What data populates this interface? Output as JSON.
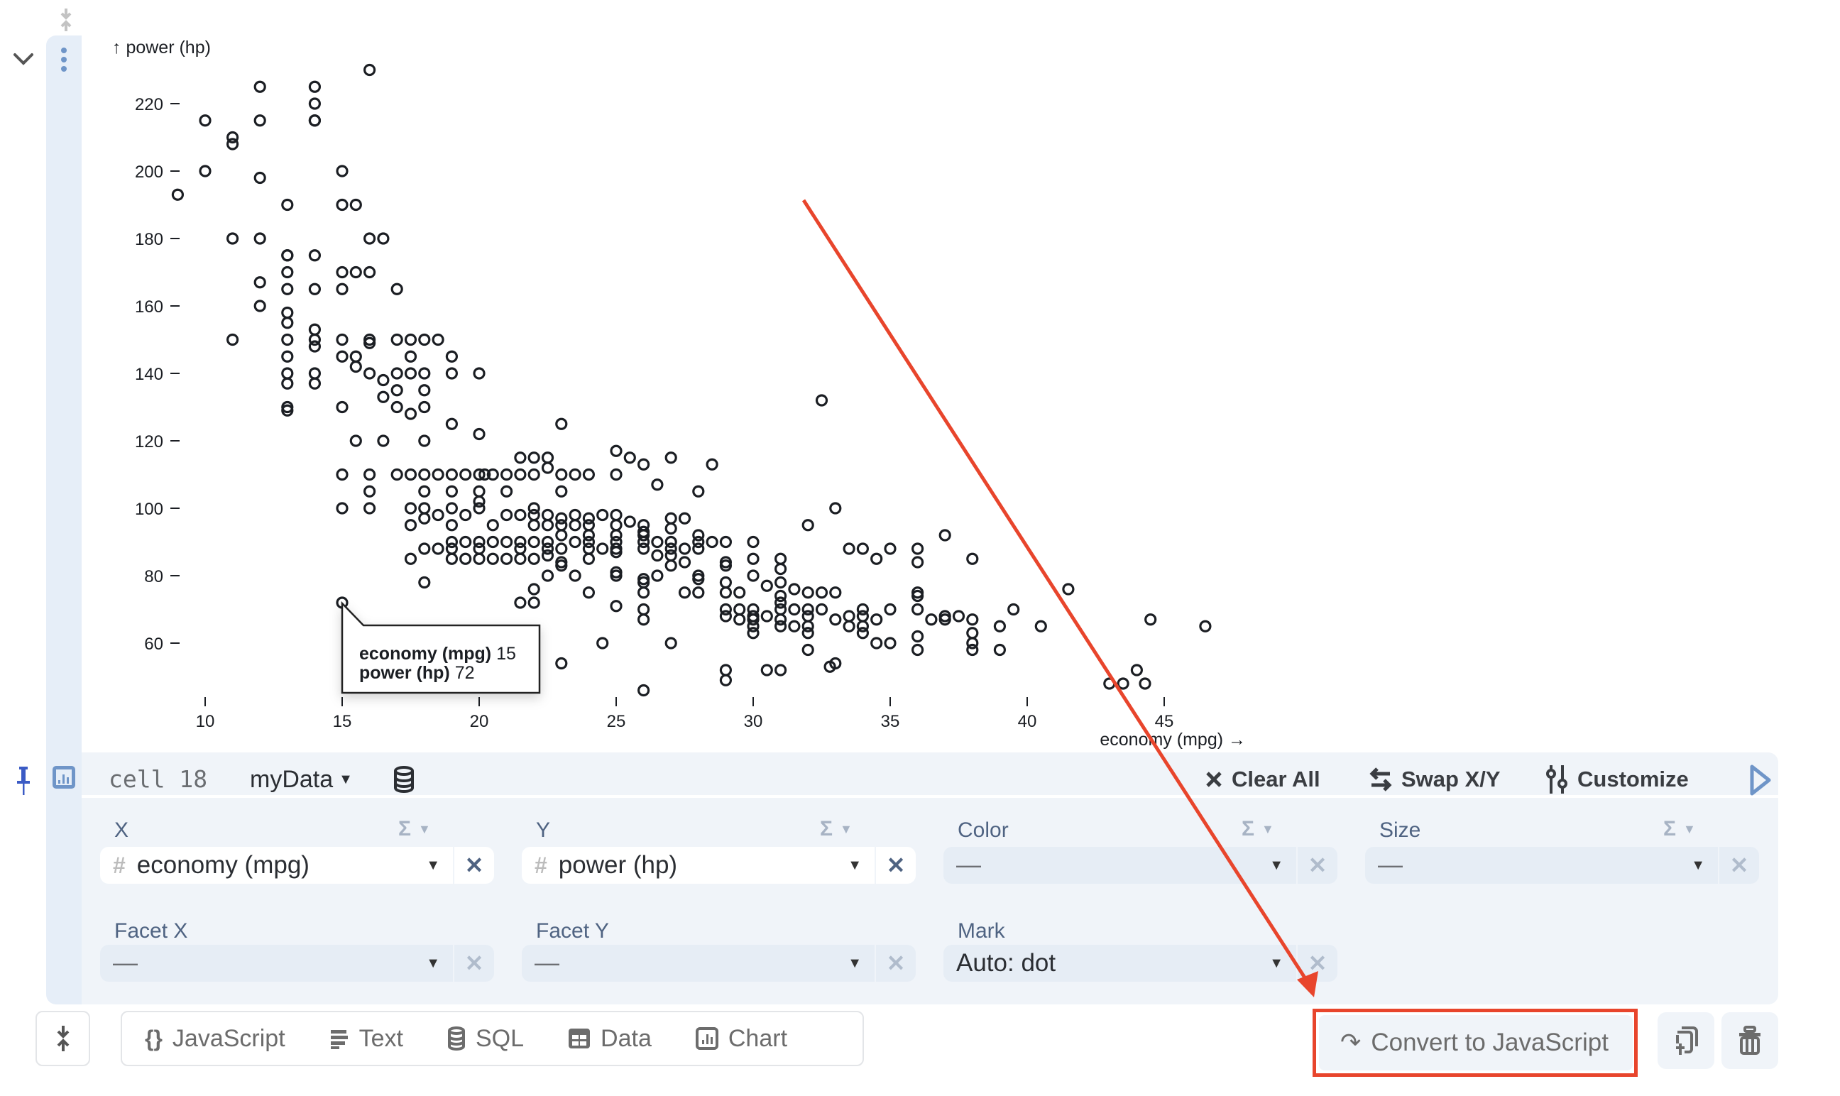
{
  "cell": {
    "label": "cell 18",
    "dataset": "myData",
    "header_buttons": {
      "clear_all": "Clear All",
      "swap": "Swap X/Y",
      "customize": "Customize"
    }
  },
  "fields": {
    "x": {
      "label": "X",
      "value": "economy (mpg)",
      "type_icon": "#"
    },
    "y": {
      "label": "Y",
      "value": "power (hp)",
      "type_icon": "#"
    },
    "color": {
      "label": "Color",
      "value": "—"
    },
    "size": {
      "label": "Size",
      "value": "—"
    },
    "facet_x": {
      "label": "Facet X",
      "value": "—"
    },
    "facet_y": {
      "label": "Facet Y",
      "value": "—"
    },
    "mark": {
      "label": "Mark",
      "value": "Auto: dot"
    },
    "aggregate_symbol": "Σ",
    "clear_symbol": "✕",
    "caret": "▾"
  },
  "toolbar": {
    "add_cells": [
      {
        "label": "JavaScript",
        "icon": "braces-icon"
      },
      {
        "label": "Text",
        "icon": "text-lines-icon"
      },
      {
        "label": "SQL",
        "icon": "database-icon"
      },
      {
        "label": "Data",
        "icon": "table-icon"
      },
      {
        "label": "Chart",
        "icon": "chart-icon"
      }
    ],
    "convert_label": "Convert to JavaScript",
    "convert_icon": "↷"
  },
  "annotation": {
    "color": "#e8452c",
    "target": "convert-button"
  },
  "chart_data": {
    "type": "scatter",
    "title": "",
    "xlabel": "economy (mpg) →",
    "ylabel": "↑ power (hp)",
    "xlim": [
      8.5,
      48
    ],
    "ylim": [
      45,
      233
    ],
    "x_ticks": [
      10,
      15,
      20,
      25,
      30,
      35,
      40,
      45
    ],
    "y_ticks": [
      60,
      80,
      100,
      120,
      140,
      160,
      180,
      200,
      220
    ],
    "grid": false,
    "legend": "none",
    "mark": "dot (hollow circle)",
    "tooltip": {
      "x_label": "economy (mpg)",
      "x_value": 15,
      "y_label": "power (hp)",
      "y_value": 72
    },
    "points": [
      [
        9,
        193
      ],
      [
        10,
        215
      ],
      [
        10,
        200
      ],
      [
        11,
        210
      ],
      [
        11,
        208
      ],
      [
        11,
        180
      ],
      [
        11,
        150
      ],
      [
        12,
        225
      ],
      [
        12,
        215
      ],
      [
        12,
        198
      ],
      [
        12,
        180
      ],
      [
        12,
        167
      ],
      [
        12,
        160
      ],
      [
        13,
        175
      ],
      [
        13,
        175
      ],
      [
        13,
        170
      ],
      [
        13,
        165
      ],
      [
        13,
        158
      ],
      [
        13,
        155
      ],
      [
        13,
        150
      ],
      [
        13,
        145
      ],
      [
        13,
        140
      ],
      [
        13,
        137
      ],
      [
        13,
        130
      ],
      [
        13,
        129
      ],
      [
        13,
        190
      ],
      [
        14,
        225
      ],
      [
        14,
        220
      ],
      [
        14,
        215
      ],
      [
        14,
        175
      ],
      [
        14,
        165
      ],
      [
        14,
        153
      ],
      [
        14,
        150
      ],
      [
        14,
        148
      ],
      [
        14,
        140
      ],
      [
        14,
        137
      ],
      [
        14,
        215
      ],
      [
        15,
        200
      ],
      [
        15,
        190
      ],
      [
        15,
        170
      ],
      [
        15,
        165
      ],
      [
        15,
        150
      ],
      [
        15,
        145
      ],
      [
        15,
        130
      ],
      [
        15,
        110
      ],
      [
        15,
        100
      ],
      [
        15,
        72
      ],
      [
        15.5,
        190
      ],
      [
        15.5,
        170
      ],
      [
        15.5,
        145
      ],
      [
        15.5,
        142
      ],
      [
        15.5,
        120
      ],
      [
        16,
        230
      ],
      [
        16,
        180
      ],
      [
        16,
        170
      ],
      [
        16,
        150
      ],
      [
        16,
        149
      ],
      [
        16,
        140
      ],
      [
        16,
        110
      ],
      [
        16,
        105
      ],
      [
        16,
        100
      ],
      [
        16.5,
        180
      ],
      [
        16.5,
        138
      ],
      [
        16.5,
        133
      ],
      [
        16.5,
        120
      ],
      [
        17,
        165
      ],
      [
        17,
        150
      ],
      [
        17,
        140
      ],
      [
        17,
        135
      ],
      [
        17,
        130
      ],
      [
        17,
        110
      ],
      [
        17.5,
        150
      ],
      [
        17.5,
        145
      ],
      [
        17.5,
        140
      ],
      [
        17.5,
        128
      ],
      [
        17.5,
        110
      ],
      [
        17.5,
        100
      ],
      [
        17.5,
        95
      ],
      [
        17.5,
        85
      ],
      [
        18,
        150
      ],
      [
        18,
        140
      ],
      [
        18,
        135
      ],
      [
        18,
        130
      ],
      [
        18,
        120
      ],
      [
        18,
        110
      ],
      [
        18,
        105
      ],
      [
        18,
        100
      ],
      [
        18,
        97
      ],
      [
        18,
        88
      ],
      [
        18,
        78
      ],
      [
        18.5,
        150
      ],
      [
        18.5,
        110
      ],
      [
        18.5,
        98
      ],
      [
        18.5,
        88
      ],
      [
        19,
        145
      ],
      [
        19,
        140
      ],
      [
        19,
        125
      ],
      [
        19,
        110
      ],
      [
        19,
        105
      ],
      [
        19,
        100
      ],
      [
        19,
        95
      ],
      [
        19,
        90
      ],
      [
        19,
        88
      ],
      [
        19,
        85
      ],
      [
        19.5,
        110
      ],
      [
        19.5,
        98
      ],
      [
        19.5,
        90
      ],
      [
        19.5,
        85
      ],
      [
        20,
        140
      ],
      [
        20,
        122
      ],
      [
        20,
        110
      ],
      [
        20,
        105
      ],
      [
        20,
        102
      ],
      [
        20,
        100
      ],
      [
        20,
        90
      ],
      [
        20,
        88
      ],
      [
        20,
        85
      ],
      [
        20.2,
        110
      ],
      [
        20.5,
        110
      ],
      [
        20.5,
        95
      ],
      [
        20.5,
        90
      ],
      [
        20.5,
        85
      ],
      [
        21,
        110
      ],
      [
        21,
        105
      ],
      [
        21,
        98
      ],
      [
        21,
        90
      ],
      [
        21,
        85
      ],
      [
        21.5,
        115
      ],
      [
        21.5,
        110
      ],
      [
        21.5,
        98
      ],
      [
        21.5,
        90
      ],
      [
        21.5,
        88
      ],
      [
        21.5,
        85
      ],
      [
        21.5,
        72
      ],
      [
        22,
        115
      ],
      [
        22,
        110
      ],
      [
        22,
        100
      ],
      [
        22,
        98
      ],
      [
        22,
        95
      ],
      [
        22,
        90
      ],
      [
        22,
        85
      ],
      [
        22,
        72
      ],
      [
        22,
        76
      ],
      [
        22.5,
        115
      ],
      [
        22.5,
        112
      ],
      [
        22.5,
        98
      ],
      [
        22.5,
        95
      ],
      [
        22.5,
        90
      ],
      [
        22.5,
        88
      ],
      [
        22.5,
        86
      ],
      [
        22.5,
        80
      ],
      [
        23,
        125
      ],
      [
        23,
        110
      ],
      [
        23,
        105
      ],
      [
        23,
        97
      ],
      [
        23,
        95
      ],
      [
        23,
        92
      ],
      [
        23,
        88
      ],
      [
        23,
        84
      ],
      [
        23,
        83
      ],
      [
        23,
        54
      ],
      [
        23.5,
        110
      ],
      [
        23.5,
        98
      ],
      [
        23.5,
        95
      ],
      [
        23.5,
        90
      ],
      [
        23.5,
        80
      ],
      [
        24,
        110
      ],
      [
        24,
        97
      ],
      [
        24,
        95
      ],
      [
        24,
        92
      ],
      [
        24,
        90
      ],
      [
        24,
        88
      ],
      [
        24,
        85
      ],
      [
        24,
        75
      ],
      [
        24.5,
        98
      ],
      [
        24.5,
        88
      ],
      [
        24.5,
        60
      ],
      [
        25,
        117
      ],
      [
        25,
        110
      ],
      [
        25,
        98
      ],
      [
        25,
        95
      ],
      [
        25,
        92
      ],
      [
        25,
        90
      ],
      [
        25,
        88
      ],
      [
        25,
        87
      ],
      [
        25,
        81
      ],
      [
        25,
        80
      ],
      [
        25,
        71
      ],
      [
        25.5,
        115
      ],
      [
        25.5,
        96
      ],
      [
        26,
        113
      ],
      [
        26,
        95
      ],
      [
        26,
        93
      ],
      [
        26,
        92
      ],
      [
        26,
        90
      ],
      [
        26,
        88
      ],
      [
        26,
        79
      ],
      [
        26,
        78
      ],
      [
        26,
        75
      ],
      [
        26,
        70
      ],
      [
        26,
        67
      ],
      [
        26,
        46
      ],
      [
        26.5,
        107
      ],
      [
        26.5,
        90
      ],
      [
        26.5,
        86
      ],
      [
        26.5,
        80
      ],
      [
        27,
        115
      ],
      [
        27,
        97
      ],
      [
        27,
        94
      ],
      [
        27,
        90
      ],
      [
        27,
        88
      ],
      [
        27,
        86
      ],
      [
        27,
        83
      ],
      [
        27,
        60
      ],
      [
        27.5,
        88
      ],
      [
        27.5,
        84
      ],
      [
        27.5,
        75
      ],
      [
        27.5,
        97
      ],
      [
        28,
        105
      ],
      [
        28,
        92
      ],
      [
        28,
        90
      ],
      [
        28,
        88
      ],
      [
        28,
        80
      ],
      [
        28,
        79
      ],
      [
        28,
        75
      ],
      [
        28.5,
        113
      ],
      [
        28.5,
        90
      ],
      [
        29,
        90
      ],
      [
        29,
        84
      ],
      [
        29,
        83
      ],
      [
        29,
        78
      ],
      [
        29,
        75
      ],
      [
        29,
        70
      ],
      [
        29,
        68
      ],
      [
        29,
        52
      ],
      [
        29,
        49
      ],
      [
        29.5,
        75
      ],
      [
        29.5,
        70
      ],
      [
        29.5,
        67
      ],
      [
        30,
        90
      ],
      [
        30,
        85
      ],
      [
        30,
        80
      ],
      [
        30,
        70
      ],
      [
        30,
        68
      ],
      [
        30,
        67
      ],
      [
        30,
        65
      ],
      [
        30,
        63
      ],
      [
        30.5,
        77
      ],
      [
        30.5,
        68
      ],
      [
        30.5,
        52
      ],
      [
        31,
        85
      ],
      [
        31,
        82
      ],
      [
        31,
        78
      ],
      [
        31,
        74
      ],
      [
        31,
        72
      ],
      [
        31,
        70
      ],
      [
        31,
        67
      ],
      [
        31,
        65
      ],
      [
        31,
        52
      ],
      [
        31.5,
        76
      ],
      [
        31.5,
        70
      ],
      [
        31.5,
        65
      ],
      [
        32,
        95
      ],
      [
        32,
        75
      ],
      [
        32,
        70
      ],
      [
        32,
        68
      ],
      [
        32,
        65
      ],
      [
        32,
        63
      ],
      [
        32,
        58
      ],
      [
        32.5,
        75
      ],
      [
        32.5,
        70
      ],
      [
        32.5,
        132
      ],
      [
        32.8,
        53
      ],
      [
        33,
        100
      ],
      [
        33,
        75
      ],
      [
        33,
        67
      ],
      [
        33,
        54
      ],
      [
        33.5,
        88
      ],
      [
        33.5,
        68
      ],
      [
        33.5,
        65
      ],
      [
        34,
        88
      ],
      [
        34,
        70
      ],
      [
        34,
        68
      ],
      [
        34,
        65
      ],
      [
        34,
        63
      ],
      [
        34.5,
        85
      ],
      [
        34.5,
        67
      ],
      [
        34.5,
        60
      ],
      [
        35,
        88
      ],
      [
        35,
        70
      ],
      [
        35,
        60
      ],
      [
        36,
        88
      ],
      [
        36,
        84
      ],
      [
        36,
        75
      ],
      [
        36,
        74
      ],
      [
        36,
        70
      ],
      [
        36,
        62
      ],
      [
        36,
        58
      ],
      [
        36.5,
        67
      ],
      [
        37,
        92
      ],
      [
        37,
        68
      ],
      [
        37,
        67
      ],
      [
        37.5,
        68
      ],
      [
        38,
        85
      ],
      [
        38,
        67
      ],
      [
        38,
        63
      ],
      [
        38,
        60
      ],
      [
        38,
        58
      ],
      [
        39,
        65
      ],
      [
        39,
        58
      ],
      [
        39.5,
        70
      ],
      [
        40.5,
        65
      ],
      [
        41.5,
        76
      ],
      [
        43,
        48
      ],
      [
        43.5,
        48
      ],
      [
        44,
        52
      ],
      [
        44.3,
        48
      ],
      [
        44.5,
        67
      ],
      [
        46.5,
        65
      ]
    ]
  }
}
